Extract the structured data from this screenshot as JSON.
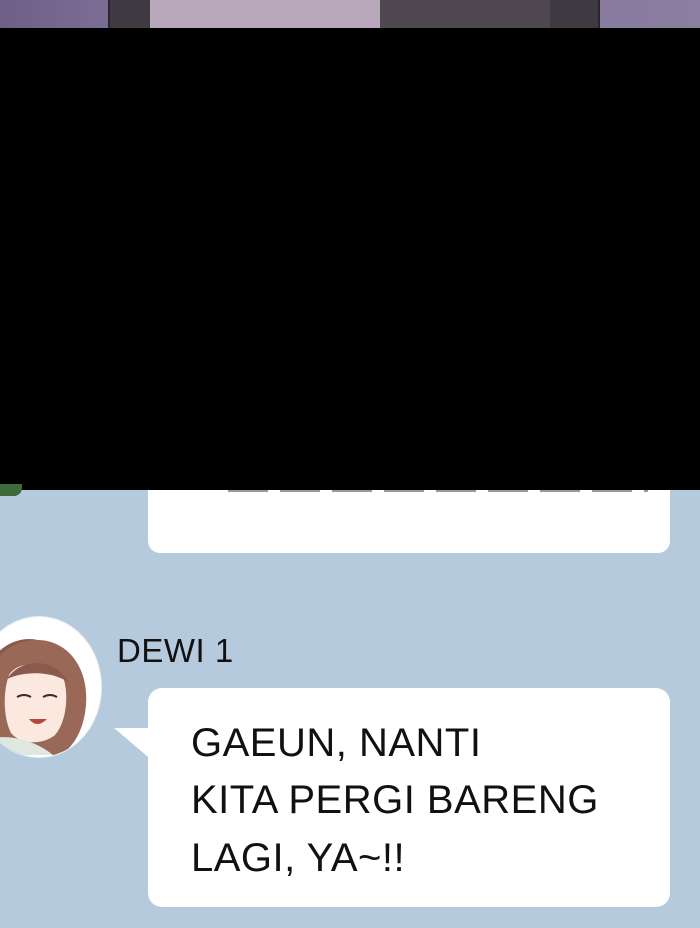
{
  "chat": {
    "sender_name": "DEWI 1",
    "message_lines": [
      "GAEUN, NANTI",
      "KITA PERGI BARENG",
      "LAGI, YA~!!"
    ]
  },
  "colors": {
    "background": "#b6cadd",
    "bubble": "#ffffff",
    "redaction": "#000000",
    "text": "#111111"
  }
}
